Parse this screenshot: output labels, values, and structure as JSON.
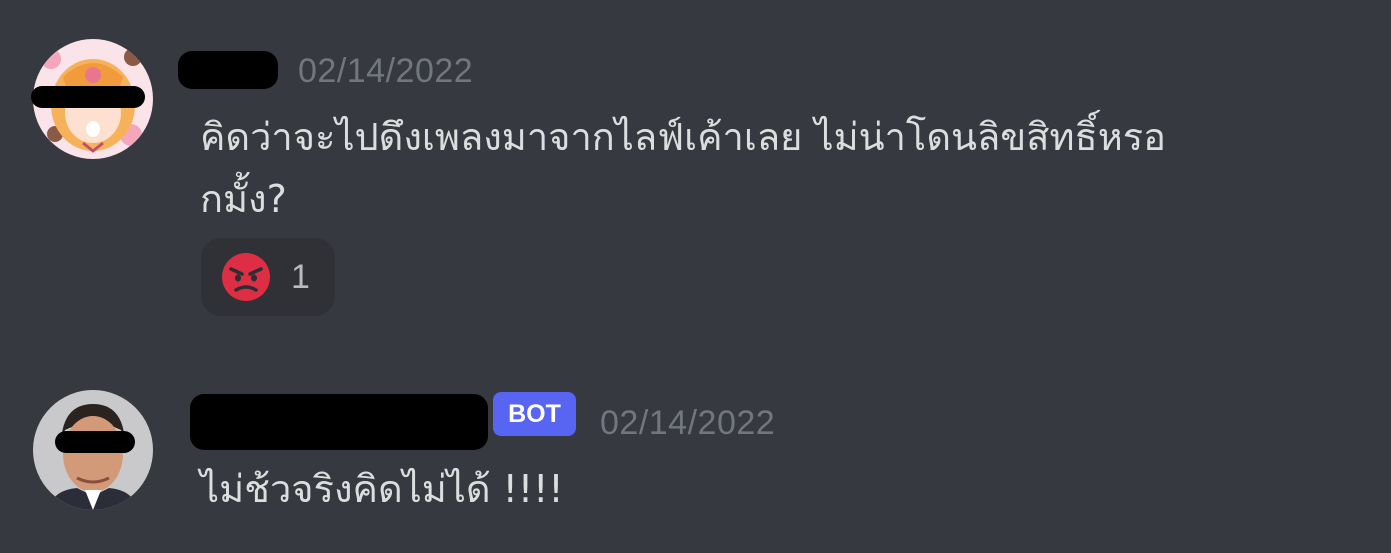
{
  "messages": [
    {
      "author_hidden": true,
      "timestamp": "02/14/2022",
      "content_line1": "คิดว่าจะไปดึงเพลงมาจากไลฟ์เค้าเลย ไม่น่าโดนลิขสิทธิ์หรอ",
      "content_line2": "กมั้ง?",
      "reaction": {
        "emoji": "angry-face-icon",
        "count": "1"
      }
    },
    {
      "author_hidden": true,
      "bot_tag": "BOT",
      "timestamp": "02/14/2022",
      "content": "ไม่ช้วจริงคิดไม่ได้ !!!!"
    }
  ],
  "colors": {
    "background": "#36393f",
    "text": "#dcddde",
    "timestamp": "#72767d",
    "reaction_bg": "#2f3136",
    "bot_tag": "#5865f2",
    "angry_red": "#dd2e44"
  }
}
